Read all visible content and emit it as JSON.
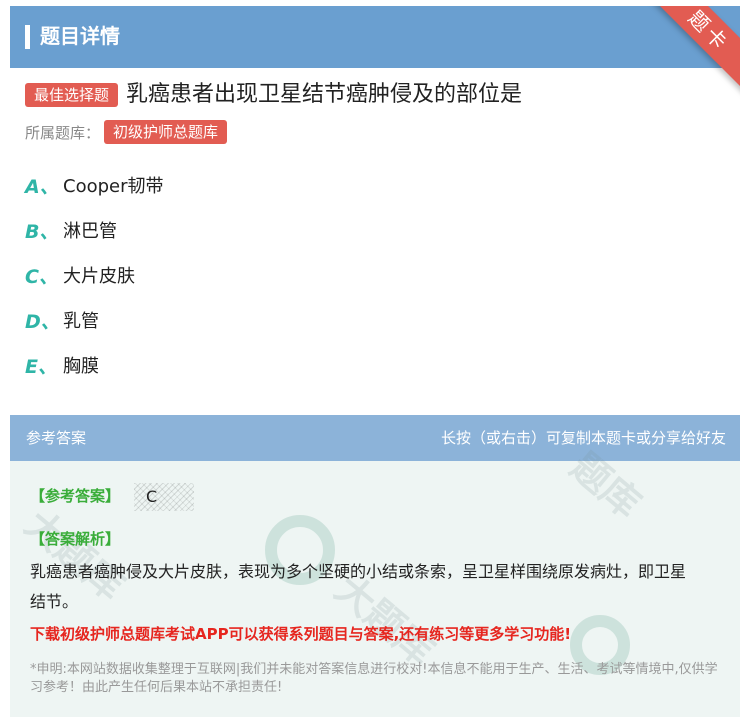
{
  "header": {
    "title": "题目详情"
  },
  "ribbon": {
    "label": "题卡"
  },
  "question": {
    "type_tag": "最佳选择题",
    "text": "乳癌患者出现卫星结节癌肿侵及的部位是",
    "bank_label": "所属题库：",
    "bank_name": "初级护师总题库"
  },
  "options": [
    {
      "letter": "A、",
      "text": "Cooper韧带"
    },
    {
      "letter": "B、",
      "text": "淋巴管"
    },
    {
      "letter": "C、",
      "text": "大片皮肤"
    },
    {
      "letter": "D、",
      "text": "乳管"
    },
    {
      "letter": "E、",
      "text": "胸膜"
    }
  ],
  "answer": {
    "header_left": "参考答案",
    "header_right": "长按（或右击）可复制本题卡或分享给好友",
    "answer_label": "【参考答案】",
    "answer_value": "C",
    "explanation_label": "【答案解析】",
    "explanation_text": "乳癌患者癌肿侵及大片皮肤，表现为多个坚硬的小结或条索，呈卫星样围绕原发病灶，即卫星结节。",
    "promo": "下载初级护师总题库考试APP可以获得系列题目与答案,还有练习等更多学习功能!",
    "disclaimer": "*申明:本网站数据收集整理于互联网|我们并未能对答案信息进行校对!本信息不能用于生产、生活、考试等情境中,仅供学习参考！由此产生任何后果本站不承担责任!"
  }
}
